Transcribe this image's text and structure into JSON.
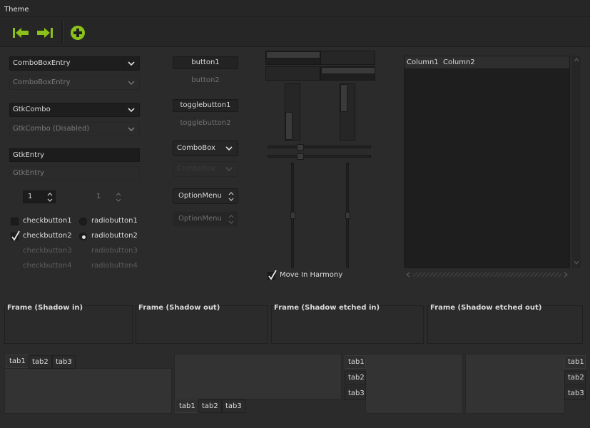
{
  "menubar": {
    "theme": "Theme"
  },
  "toolbar": {
    "back_icon": "arrow-left-icon",
    "forward_icon": "arrow-right-icon",
    "add_icon": "add-circle-icon",
    "accent": "#8ac11a"
  },
  "col1": {
    "combo_entry": "ComboBoxEntry",
    "combo_entry_disabled": "ComboBoxEntry",
    "gtk_combo": "GtkCombo",
    "gtk_combo_disabled": "GtkCombo (Disabled)",
    "entry": "GtkEntry",
    "entry_disabled": "GtkEntry",
    "spin": "1",
    "spin_disabled": "1",
    "checks": [
      "checkbutton1",
      "checkbutton2",
      "checkbutton3",
      "checkbutton4"
    ],
    "radios": [
      "radiobutton1",
      "radiobutton2",
      "radiobutton3",
      "radiobutton4"
    ]
  },
  "col2": {
    "button1": "button1",
    "button2": "button2",
    "toggle1": "togglebutton1",
    "toggle2": "togglebutton2",
    "combobox": "ComboBox",
    "combobox_disabled": "ComboBox",
    "option1": "OptionMenu",
    "option2": "OptionMenu"
  },
  "col3": {
    "harmony": "Move In Harmony"
  },
  "tree": {
    "col1": "Column1",
    "col2": "Column2"
  },
  "frames": [
    "Frame (Shadow in)",
    "Frame (Shadow out)",
    "Frame (Shadow etched in)",
    "Frame (Shadow etched out)"
  ],
  "tabs": [
    "tab1",
    "tab2",
    "tab3"
  ]
}
